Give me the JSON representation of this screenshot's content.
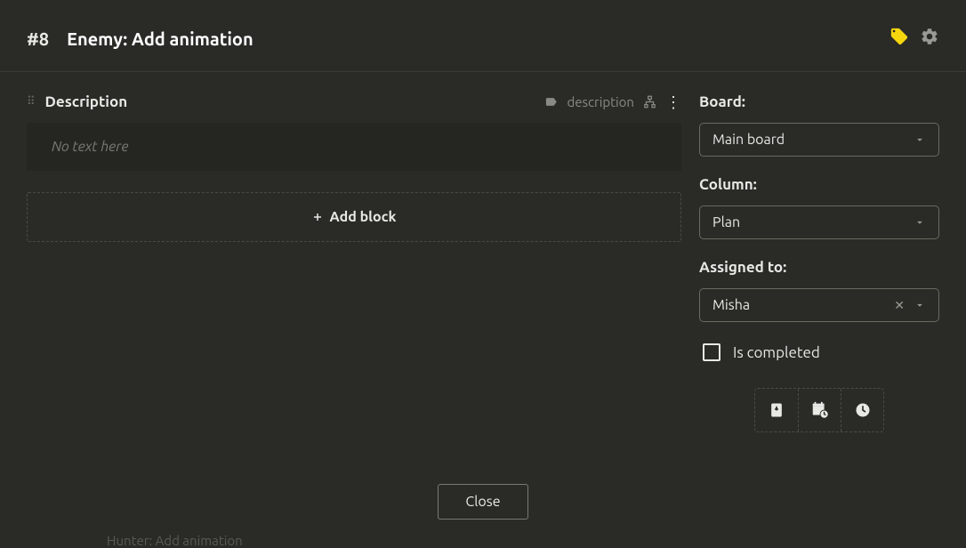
{
  "header": {
    "issue_number": "#8",
    "title": "Enemy: Add animation"
  },
  "description": {
    "section_title": "Description",
    "meta_label": "description",
    "placeholder": "No text here",
    "add_block_label": "Add block"
  },
  "sidebar": {
    "board": {
      "label": "Board:",
      "value": "Main board"
    },
    "column": {
      "label": "Column:",
      "value": "Plan"
    },
    "assigned": {
      "label": "Assigned to:",
      "value": "Misha"
    },
    "completed": {
      "label": "Is completed"
    }
  },
  "footer": {
    "close_label": "Close"
  },
  "peek": "Hunter: Add animation"
}
